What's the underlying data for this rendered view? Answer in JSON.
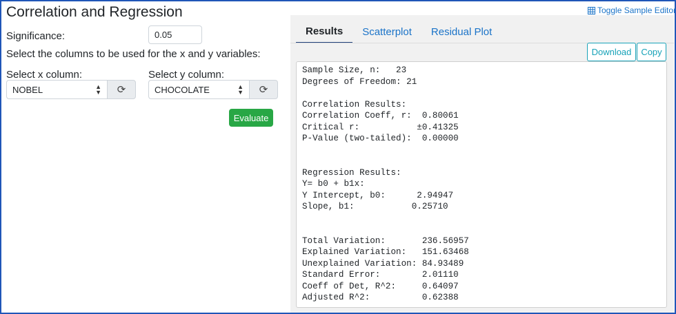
{
  "page": {
    "title": "Correlation and Regression"
  },
  "form": {
    "significance_label": "Significance:",
    "significance_value": "0.05",
    "columns_prompt": "Select the columns to be used for the x and y variables:",
    "x_label": "Select x column:",
    "x_value": "NOBEL",
    "y_label": "Select y column:",
    "y_value": "CHOCOLATE",
    "evaluate_label": "Evaluate"
  },
  "toolbar": {
    "toggle_label": "Toggle Sample Editor"
  },
  "tabs": [
    {
      "label": "Results",
      "active": true
    },
    {
      "label": "Scatterplot",
      "active": false
    },
    {
      "label": "Residual Plot",
      "active": false
    }
  ],
  "actions": {
    "download_label": "Download",
    "copy_label": "Copy"
  },
  "output": {
    "lines": [
      "Sample Size, n:   23",
      "Degrees of Freedom: 21",
      "",
      "Correlation Results:",
      "Correlation Coeff, r:  0.80061",
      "Critical r:           ±0.41325",
      "P-Value (two-tailed):  0.00000",
      "",
      "",
      "Regression Results:",
      "Y= b0 + b1x:",
      "Y Intercept, b0:      2.94947",
      "Slope, b1:           0.25710",
      "",
      "",
      "Total Variation:       236.56957",
      "Explained Variation:   151.63468",
      "Unexplained Variation: 84.93489",
      "Standard Error:        2.01110",
      "Coeff of Det, R^2:     0.64097",
      "Adjusted R^2:          0.62388"
    ]
  },
  "icons": {
    "refresh": "refresh-icon",
    "table": "table-icon",
    "select_chevron": "chevron-updown-icon"
  },
  "colors": {
    "accent": "#1a73c8",
    "evaluate": "#28a745",
    "outline": "#17a2b8",
    "frame": "#1f56b8"
  }
}
